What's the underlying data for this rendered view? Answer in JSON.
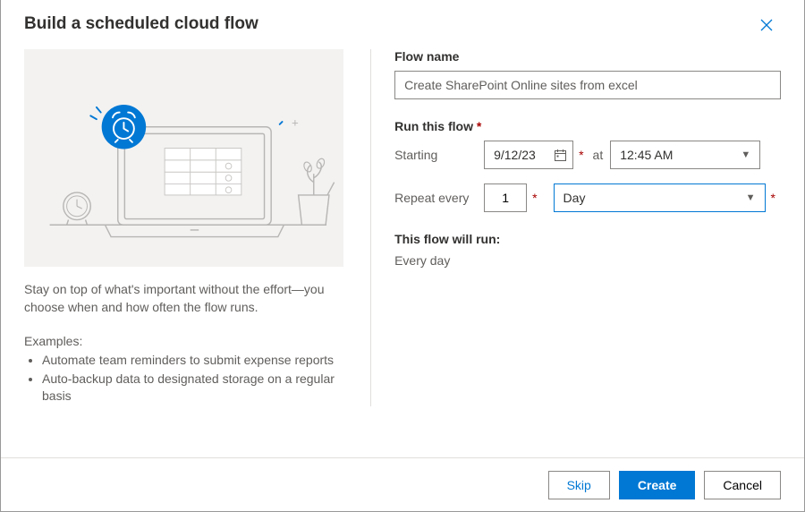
{
  "header": {
    "title": "Build a scheduled cloud flow"
  },
  "left": {
    "description": "Stay on top of what's important without the effort—you choose when and how often the flow runs.",
    "examples_heading": "Examples:",
    "examples": [
      "Automate team reminders to submit expense reports",
      "Auto-backup data to designated storage on a regular basis"
    ]
  },
  "form": {
    "flow_name_label": "Flow name",
    "flow_name_value": "Create SharePoint Online sites from excel",
    "run_flow_label": "Run this flow",
    "starting_label": "Starting",
    "starting_date": "9/12/23",
    "at_label": "at",
    "starting_time": "12:45 AM",
    "repeat_label": "Repeat every",
    "repeat_value": "1",
    "repeat_unit": "Day",
    "will_run_label": "This flow will run:",
    "will_run_value": "Every day"
  },
  "footer": {
    "skip": "Skip",
    "create": "Create",
    "cancel": "Cancel"
  }
}
